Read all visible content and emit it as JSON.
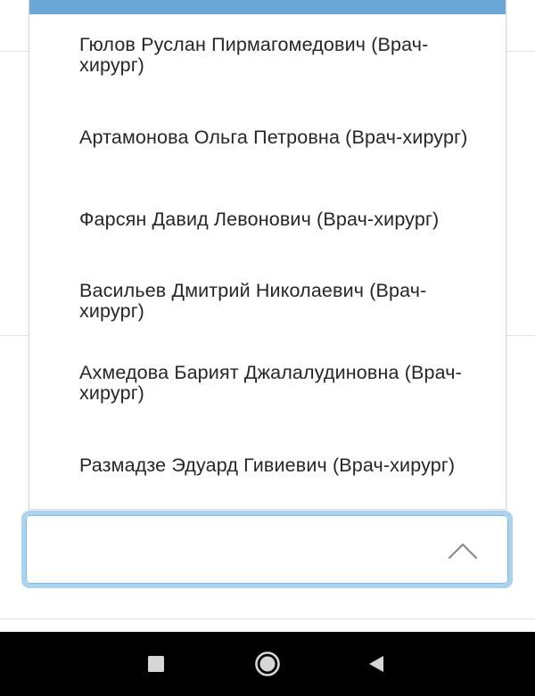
{
  "dropdown": {
    "options": [
      {
        "label": "Гюлов Руслан Пирмагомедович (Врач-хирург)"
      },
      {
        "label": "Артамонова Ольга Петровна (Врач-хирург)"
      },
      {
        "label": "Фарсян Давид Левонович (Врач-хирург)"
      },
      {
        "label": "Васильев Дмитрий Николаевич (Врач-хирург)"
      },
      {
        "label": "Ахмедова Барият Джалалудиновна (Врач-хирург)"
      },
      {
        "label": "Размадзе Эдуард Гивиевич (Врач-хирург)"
      }
    ],
    "highlight_color": "#6aa6d6"
  },
  "select": {
    "value": "",
    "focus_border_color": "#aad3f2",
    "expanded_icon": "chevron-up-icon"
  },
  "navbar": {
    "buttons": [
      "recents-square-icon",
      "home-circle-icon",
      "back-triangle-icon"
    ]
  }
}
